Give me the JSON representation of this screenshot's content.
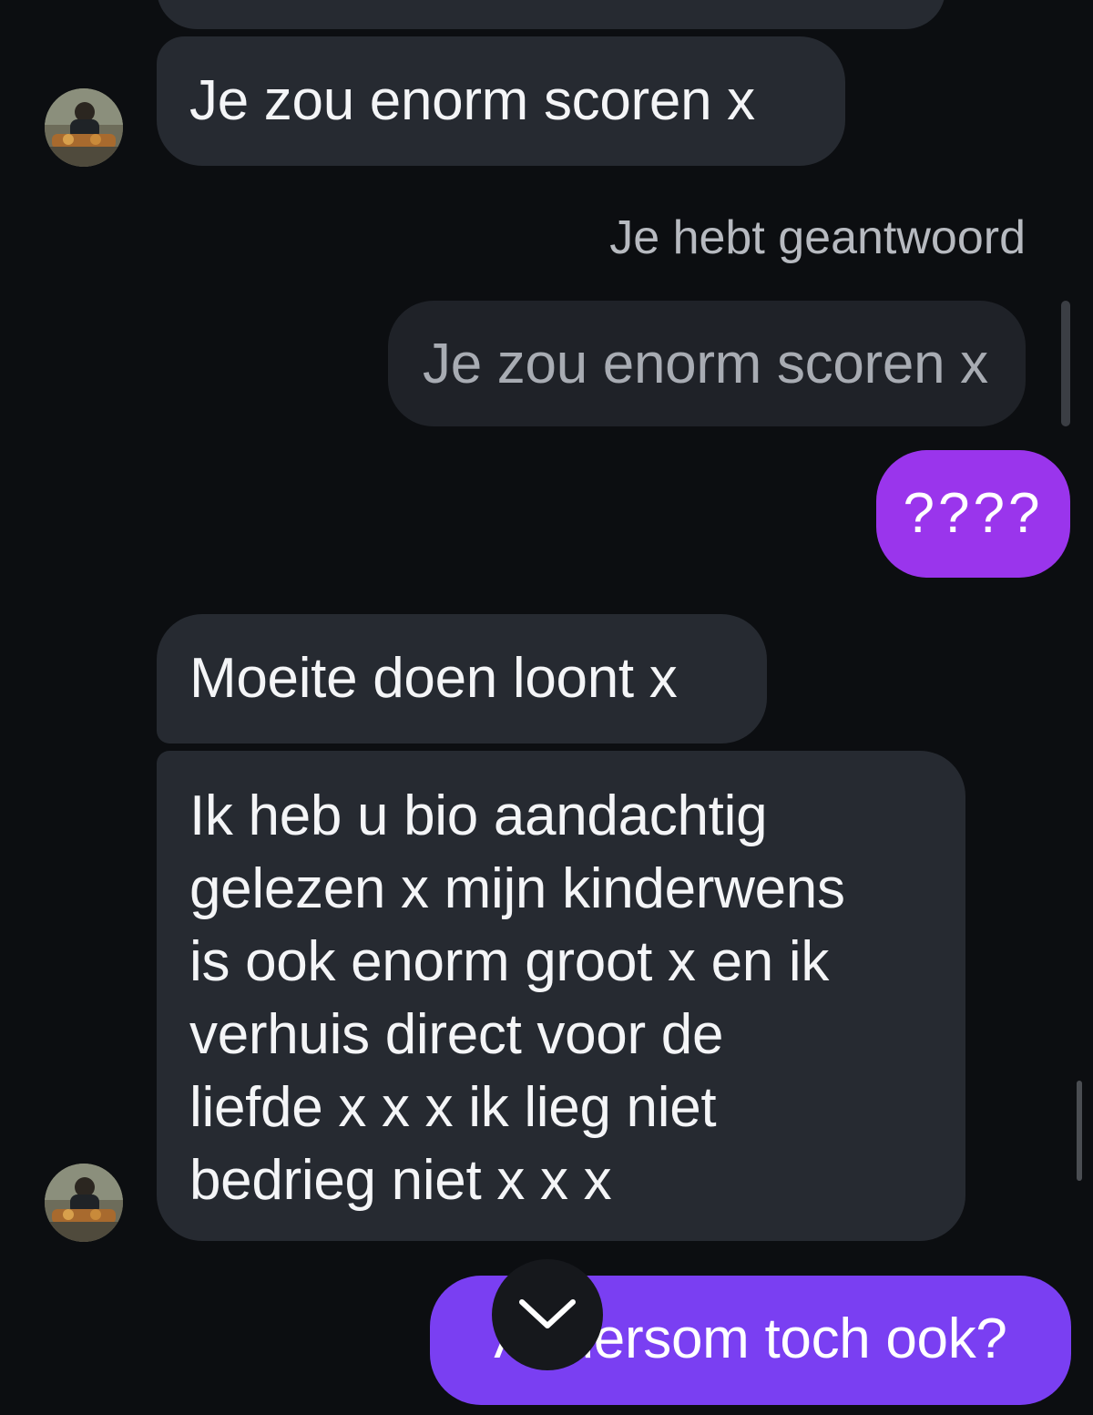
{
  "conversation": {
    "messages": [
      {
        "direction": "incoming",
        "text": "Je zou enorm scoren x"
      },
      {
        "direction": "system",
        "text": "Je hebt geantwoord"
      },
      {
        "direction": "quoted",
        "text": "Je zou enorm scoren x"
      },
      {
        "direction": "outgoing",
        "text": "????"
      },
      {
        "direction": "incoming",
        "text": "Moeite doen loont x"
      },
      {
        "direction": "incoming",
        "lines": [
          "Ik heb u bio aandachtig",
          "gelezen x mijn kinderwens",
          "is ook enorm groot x en ik",
          "verhuis direct voor de",
          "liefde x x x ik lieg niet",
          "bedrieg niet x x x"
        ]
      },
      {
        "direction": "outgoing",
        "text": "Andersom toch ook?"
      }
    ]
  },
  "colors": {
    "background": "#0c0e11",
    "incoming_bubble": "#262a31",
    "quoted_bubble": "#1f2228",
    "outgoing_bubble_top": "#9a35ec",
    "outgoing_bubble_bottom": "#7a3ff2"
  },
  "icons": {
    "scroll_down": "chevron-down-icon",
    "avatar": "profile-photo"
  }
}
